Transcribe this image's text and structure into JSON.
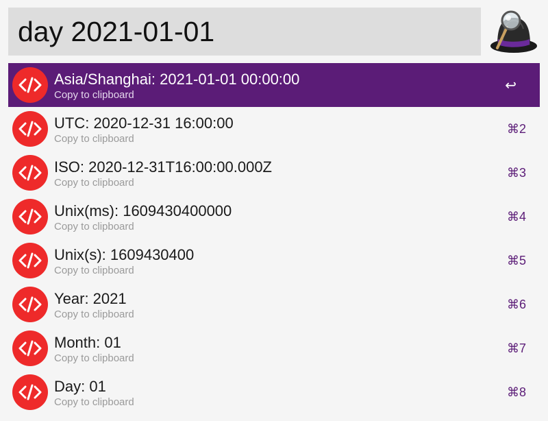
{
  "search": {
    "query": "day 2021-01-01"
  },
  "app_logo": {
    "icon": "alfred-hat-logo"
  },
  "colors": {
    "selection": "#5b1c77",
    "icon_bg": "#ee2a2a",
    "shortcut": "#5b1c77"
  },
  "results": [
    {
      "title": "Asia/Shanghai: 2021-01-01 00:00:00",
      "subtitle": "Copy to clipboard",
      "shortcut": "↩",
      "icon": "code-icon",
      "selected": true
    },
    {
      "title": "UTC: 2020-12-31 16:00:00",
      "subtitle": "Copy to clipboard",
      "shortcut": "⌘2",
      "icon": "code-icon"
    },
    {
      "title": "ISO: 2020-12-31T16:00:00.000Z",
      "subtitle": "Copy to clipboard",
      "shortcut": "⌘3",
      "icon": "code-icon"
    },
    {
      "title": "Unix(ms): 1609430400000",
      "subtitle": "Copy to clipboard",
      "shortcut": "⌘4",
      "icon": "code-icon"
    },
    {
      "title": "Unix(s): 1609430400",
      "subtitle": "Copy to clipboard",
      "shortcut": "⌘5",
      "icon": "code-icon"
    },
    {
      "title": "Year: 2021",
      "subtitle": "Copy to clipboard",
      "shortcut": "⌘6",
      "icon": "code-icon"
    },
    {
      "title": "Month: 01",
      "subtitle": "Copy to clipboard",
      "shortcut": "⌘7",
      "icon": "code-icon"
    },
    {
      "title": "Day: 01",
      "subtitle": "Copy to clipboard",
      "shortcut": "⌘8",
      "icon": "code-icon"
    }
  ]
}
